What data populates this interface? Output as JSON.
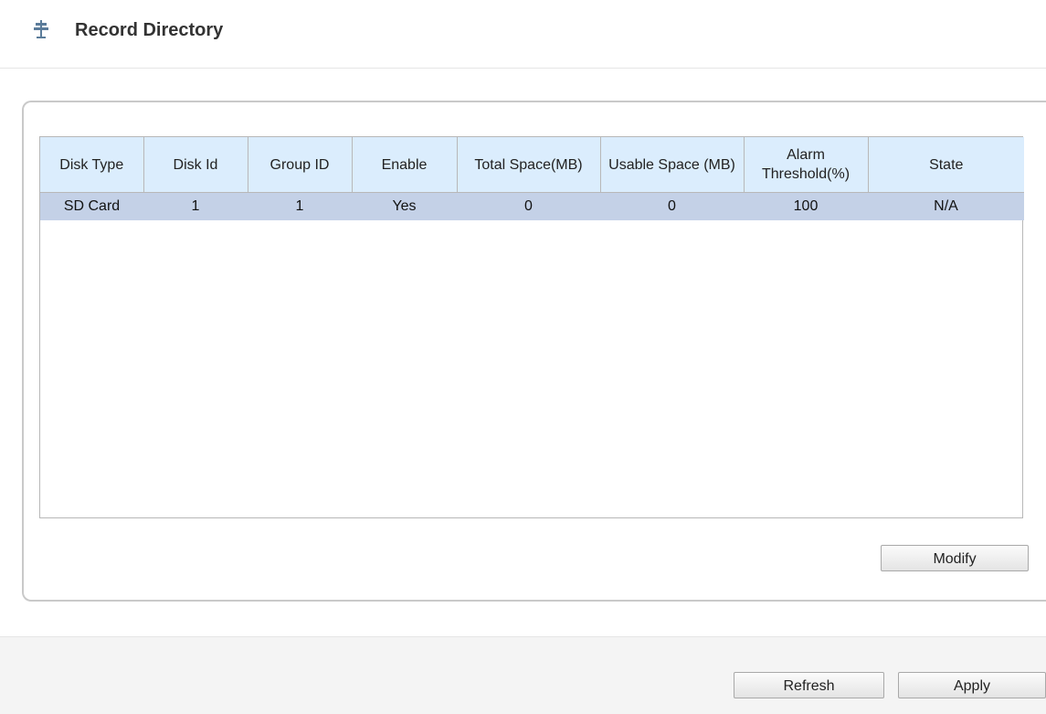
{
  "header": {
    "title": "Record Directory",
    "icon": "signpost-icon"
  },
  "table": {
    "columns": [
      "Disk Type",
      "Disk Id",
      "Group ID",
      "Enable",
      "Total Space(MB)",
      "Usable Space (MB)",
      "Alarm Threshold(%)",
      "State"
    ],
    "rows": [
      [
        "SD Card",
        "1",
        "1",
        "Yes",
        "0",
        "0",
        "100",
        "N/A"
      ]
    ]
  },
  "buttons": {
    "modify": "Modify",
    "refresh": "Refresh",
    "apply": "Apply"
  },
  "colors": {
    "header_bg": "#dbedfd",
    "selected_row": "#c4d1e7",
    "icon": "#5b7c9a"
  }
}
